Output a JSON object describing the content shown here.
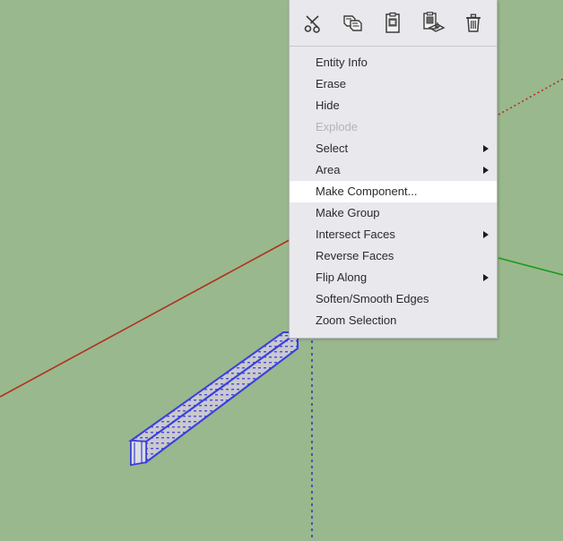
{
  "viewport": {
    "name": "sketchup-3d-viewport",
    "background_color": "#9ab88d",
    "axes": {
      "red_axis_color": "#b03020",
      "green_axis_color": "#1a9a1a",
      "blue_axis_color": "#3a4fa8"
    },
    "selection": {
      "edge_color": "#3a42d8",
      "face_color": "#c9c9cf",
      "object": "rectangular beam",
      "state": "selected"
    }
  },
  "context_menu": {
    "toolbar": {
      "buttons": [
        {
          "name": "cut-button",
          "icon": "scissors-icon",
          "label": "Cut"
        },
        {
          "name": "copy-button",
          "icon": "copy-pages-icon",
          "label": "Copy"
        },
        {
          "name": "paste-button",
          "icon": "clipboard-paste-icon",
          "label": "Paste"
        },
        {
          "name": "paste-in-place-button",
          "icon": "clipboard-paste-in-place-icon",
          "label": "Paste In Place"
        },
        {
          "name": "delete-button",
          "icon": "trash-icon",
          "label": "Delete"
        }
      ]
    },
    "items": [
      {
        "label": "Entity Info",
        "submenu": false,
        "disabled": false,
        "highlighted": false
      },
      {
        "label": "Erase",
        "submenu": false,
        "disabled": false,
        "highlighted": false
      },
      {
        "label": "Hide",
        "submenu": false,
        "disabled": false,
        "highlighted": false
      },
      {
        "label": "Explode",
        "submenu": false,
        "disabled": true,
        "highlighted": false
      },
      {
        "label": "Select",
        "submenu": true,
        "disabled": false,
        "highlighted": false
      },
      {
        "label": "Area",
        "submenu": true,
        "disabled": false,
        "highlighted": false
      },
      {
        "label": "Make Component...",
        "submenu": false,
        "disabled": false,
        "highlighted": true
      },
      {
        "label": "Make Group",
        "submenu": false,
        "disabled": false,
        "highlighted": false
      },
      {
        "label": "Intersect Faces",
        "submenu": true,
        "disabled": false,
        "highlighted": false
      },
      {
        "label": "Reverse Faces",
        "submenu": false,
        "disabled": false,
        "highlighted": false
      },
      {
        "label": "Flip Along",
        "submenu": true,
        "disabled": false,
        "highlighted": false
      },
      {
        "label": "Soften/Smooth Edges",
        "submenu": false,
        "disabled": false,
        "highlighted": false
      },
      {
        "label": "Zoom Selection",
        "submenu": false,
        "disabled": false,
        "highlighted": false
      }
    ]
  }
}
